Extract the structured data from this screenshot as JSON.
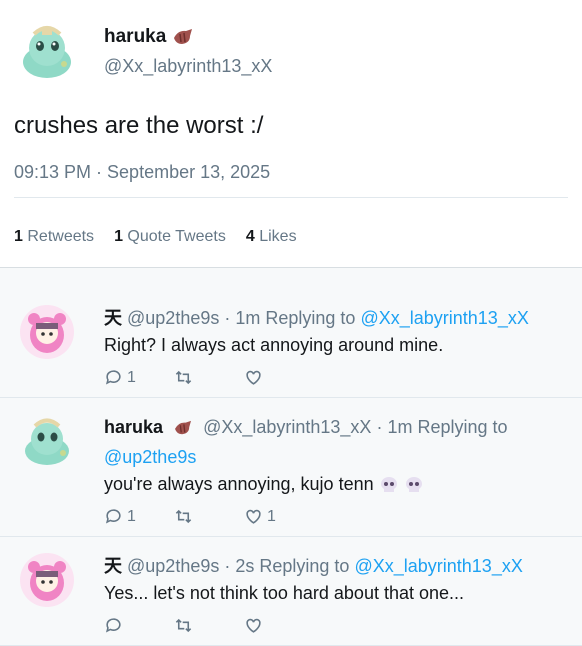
{
  "main_tweet": {
    "name": "haruka",
    "name_emoji": "horn-icon",
    "handle": "@Xx_labyrinth13_xX",
    "text": "crushes are the worst :/",
    "timestamp": "09:13 PM · September 13, 2025",
    "stats": {
      "retweets_count": "1",
      "retweets_label": "Retweets",
      "quotes_count": "1",
      "quotes_label": "Quote Tweets",
      "likes_count": "4",
      "likes_label": "Likes"
    }
  },
  "replies": [
    {
      "name": "天",
      "handle": "@up2the9s",
      "time": "1m",
      "replying_label": "Replying to",
      "replying_to": "@Xx_labyrinth13_xX",
      "text": "Right? I always act annoying around mine.",
      "reply_count": "1",
      "retweet_count": "",
      "like_count": ""
    },
    {
      "name": "haruka",
      "handle": "@Xx_labyrinth13_xX",
      "time": "1m",
      "replying_label": "Replying to",
      "replying_to": "@up2the9s",
      "text": "you're always annoying, kujo tenn",
      "reply_count": "1",
      "retweet_count": "",
      "like_count": "1"
    },
    {
      "name": "天",
      "handle": "@up2the9s",
      "time": "2s",
      "replying_label": "Replying to",
      "replying_to": "@Xx_labyrinth13_xX",
      "text": "Yes... let's not think too hard about that one...",
      "reply_count": "",
      "retweet_count": "",
      "like_count": ""
    }
  ],
  "colors": {
    "link": "#1da1f2",
    "muted": "#657786",
    "text": "#14171a",
    "background": "#f7f9fa"
  }
}
